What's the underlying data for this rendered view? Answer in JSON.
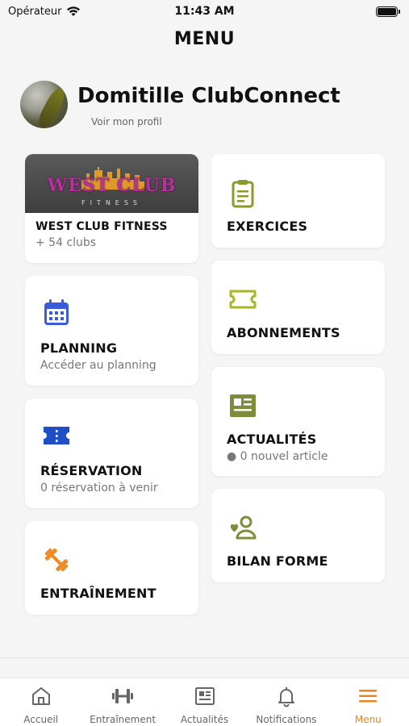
{
  "status_bar": {
    "carrier": "Opérateur",
    "time": "11:43 AM"
  },
  "page": {
    "title": "MENU"
  },
  "profile": {
    "name": "Domitille ClubConnect",
    "link_label": "Voir mon profil"
  },
  "club_card": {
    "logo_text": "WEST CLUB",
    "logo_sub": "FITNESS",
    "title": "WEST CLUB FITNESS",
    "subtitle": "+ 54 clubs"
  },
  "cards": {
    "exercices": {
      "title": "EXERCICES",
      "icon": "clipboard-icon",
      "color": "#8b9a2b"
    },
    "planning": {
      "title": "PLANNING",
      "subtitle": "Accéder au planning",
      "icon": "calendar-icon",
      "color": "#3b5bdb"
    },
    "abonnements": {
      "title": "ABONNEMENTS",
      "icon": "ticket-icon",
      "color": "#a8b820"
    },
    "reservation": {
      "title": "RÉSERVATION",
      "subtitle": "0 réservation à venir",
      "icon": "ticket-icon",
      "color": "#1e4fc8"
    },
    "actualites": {
      "title": "ACTUALITÉS",
      "subtitle": "● 0 nouvel article",
      "icon": "newspaper-icon",
      "color": "#7f8c3a"
    },
    "entrainement": {
      "title": "ENTRAÎNEMENT",
      "icon": "dumbbell-icon",
      "color": "#f08a24"
    },
    "bilan_forme": {
      "title": "BILAN FORME",
      "icon": "user-heart-icon",
      "color": "#7f8c3a"
    }
  },
  "tab_bar": {
    "items": [
      {
        "label": "Accueil",
        "icon": "home-icon"
      },
      {
        "label": "Entraînement",
        "icon": "dumbbell-icon"
      },
      {
        "label": "Actualités",
        "icon": "newspaper-icon"
      },
      {
        "label": "Notifications",
        "icon": "bell-icon"
      },
      {
        "label": "Menu",
        "icon": "menu-icon",
        "active": true
      }
    ],
    "active_color": "#e8871e",
    "inactive_color": "#666666"
  }
}
